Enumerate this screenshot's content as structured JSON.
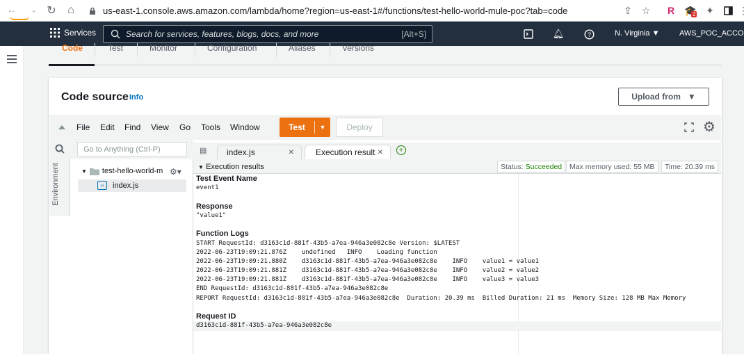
{
  "browser": {
    "url": "us-east-1.console.aws.amazon.com/lambda/home?region=us-east-1#/functions/test-hello-world-mule-poc?tab=code",
    "ext_badge": "2",
    "ext_letter": "R"
  },
  "aws_nav": {
    "logo": "aws",
    "services_label": "Services",
    "search_placeholder": "Search for services, features, blogs, docs, and more",
    "search_shortcut": "[Alt+S]",
    "region": "N. Virginia ▼",
    "account": "AWS_POC_ACCOUN"
  },
  "function_tabs": [
    "Code",
    "Test",
    "Monitor",
    "Configuration",
    "Aliases",
    "Versions"
  ],
  "code_source": {
    "title": "Code source",
    "info": "Info",
    "upload_label": "Upload from",
    "upload_caret": "▼"
  },
  "ide": {
    "menus": [
      "File",
      "Edit",
      "Find",
      "View",
      "Go",
      "Tools",
      "Window"
    ],
    "test_label": "Test",
    "deploy_label": "Deploy",
    "goto_placeholder": "Go to Anything (Ctrl-P)",
    "environment_label": "Environment",
    "folder_name": "test-hello-world-m",
    "file_name": "index.js",
    "editor_tabs": [
      {
        "label": "index.js"
      },
      {
        "label": "Execution result"
      }
    ],
    "results_title": "Execution results",
    "status_label": "Status: ",
    "status_value": "Succeeded",
    "max_memory": "Max memory used: 55 MB",
    "time": "Time: 20.39 ms"
  },
  "output": {
    "test_event_heading": "Test Event Name",
    "test_event_value": "event1",
    "response_heading": "Response",
    "response_value": "\"value1\"",
    "logs_heading": "Function Logs",
    "logs": [
      "START RequestId: d3163c1d-881f-43b5-a7ea-946a3e082c8e Version: $LATEST",
      "2022-06-23T19:09:21.876Z    undefined   INFO    Loading function",
      "2022-06-23T19:09:21.880Z    d3163c1d-881f-43b5-a7ea-946a3e082c8e    INFO    value1 = value1",
      "2022-06-23T19:09:21.881Z    d3163c1d-881f-43b5-a7ea-946a3e082c8e    INFO    value2 = value2",
      "2022-06-23T19:09:21.881Z    d3163c1d-881f-43b5-a7ea-946a3e082c8e    INFO    value3 = value3",
      "END RequestId: d3163c1d-881f-43b5-a7ea-946a3e082c8e",
      "REPORT RequestId: d3163c1d-881f-43b5-a7ea-946a3e082c8e  Duration: 20.39 ms  Billed Duration: 21 ms  Memory Size: 128 MB Max Memory"
    ],
    "request_id_heading": "Request ID",
    "request_id_value": "d3163c1d-881f-43b5-a7ea-946a3e082c8e"
  }
}
